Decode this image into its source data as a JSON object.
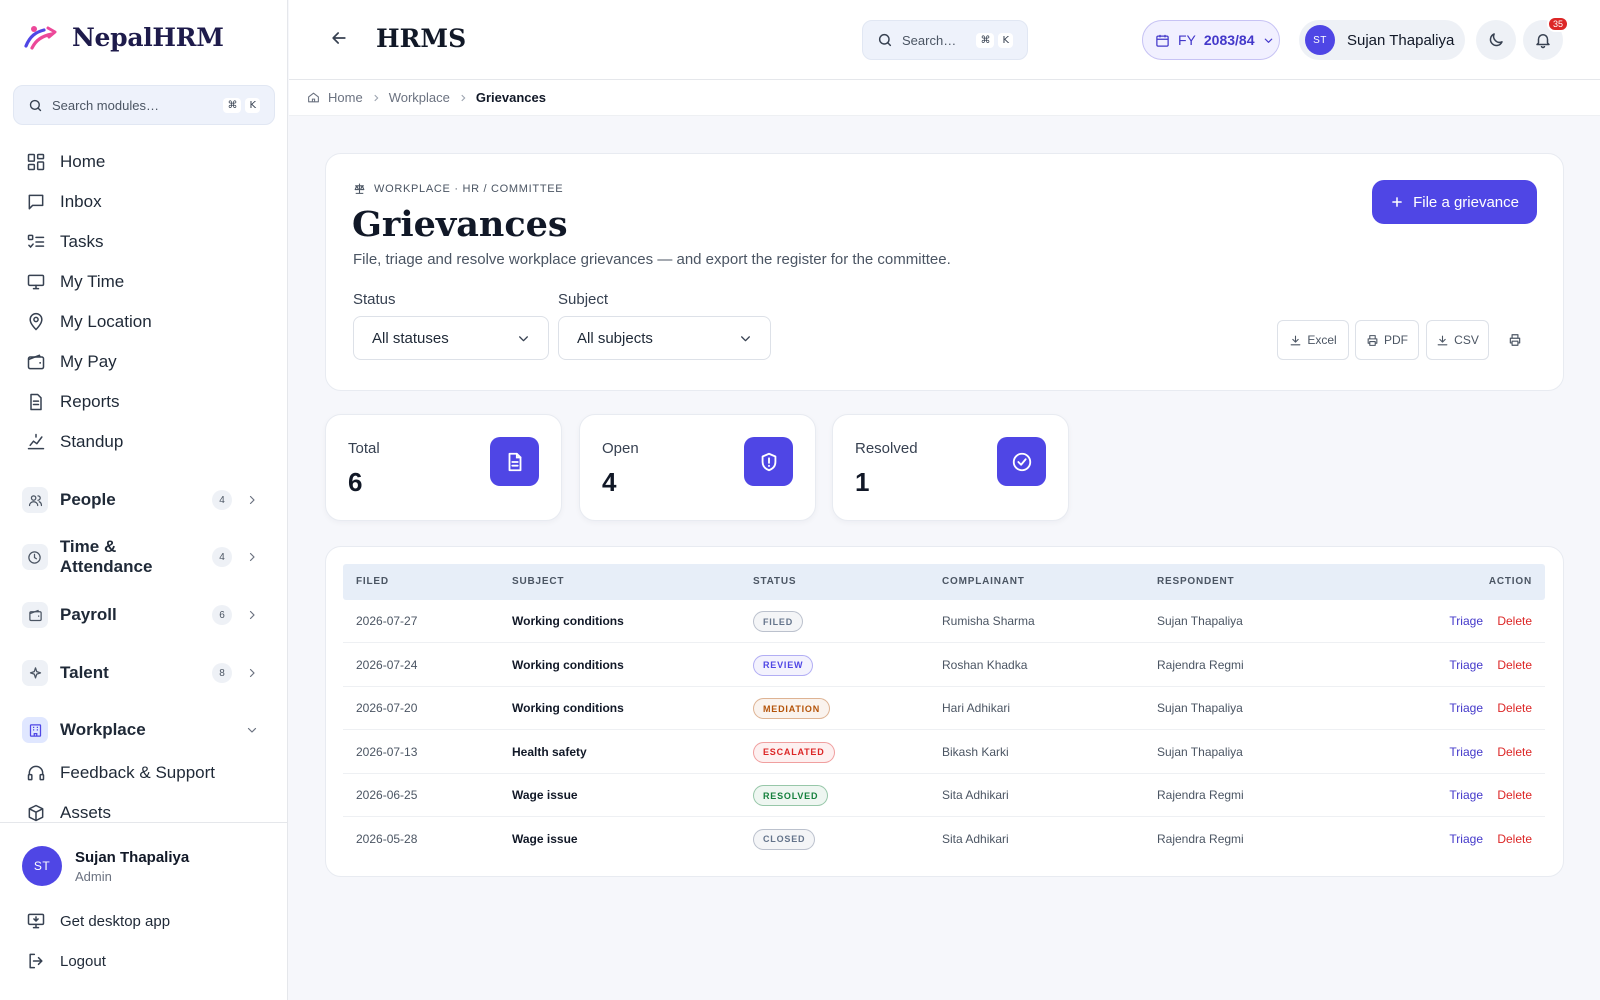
{
  "brand": {
    "name": "NepalHRM"
  },
  "sidebar": {
    "search_placeholder": "Search modules…",
    "kbd": [
      "⌘",
      "K"
    ],
    "items": [
      {
        "label": "Home",
        "icon": "dashboard-icon"
      },
      {
        "label": "Inbox",
        "icon": "message-icon"
      },
      {
        "label": "Tasks",
        "icon": "checklist-icon"
      },
      {
        "label": "My Time",
        "icon": "monitor-icon"
      },
      {
        "label": "My Location",
        "icon": "map-pin-icon"
      },
      {
        "label": "My Pay",
        "icon": "wallet-icon"
      },
      {
        "label": "Reports",
        "icon": "document-icon"
      },
      {
        "label": "Standup",
        "icon": "standup-icon"
      }
    ],
    "groups": [
      {
        "label": "People",
        "count": "4",
        "icon": "users-icon"
      },
      {
        "label": "Time & Attendance",
        "count": "4",
        "icon": "clock-icon"
      },
      {
        "label": "Payroll",
        "count": "6",
        "icon": "wallet-icon"
      },
      {
        "label": "Talent",
        "count": "8",
        "icon": "sparkle-icon"
      },
      {
        "label": "Workplace",
        "icon": "building-icon"
      }
    ],
    "sub_items": [
      {
        "label": "Feedback & Support",
        "icon": "headset-icon"
      },
      {
        "label": "Assets",
        "icon": "box-icon"
      }
    ],
    "profile": {
      "initials": "ST",
      "name": "Sujan Thapaliya",
      "role": "Admin"
    },
    "desktop_app": "Get desktop app",
    "logout": "Logout"
  },
  "header": {
    "title": "HRMS",
    "search_placeholder": "Search…",
    "kbd": [
      "⌘",
      "K"
    ],
    "fy_prefix": "FY",
    "fy_value": "2083/84",
    "user_initials": "ST",
    "user_name": "Sujan Thapaliya",
    "notifications": "35"
  },
  "breadcrumb": {
    "home": "Home",
    "section": "Workplace",
    "current": "Grievances"
  },
  "page": {
    "eyebrow": "WORKPLACE · HR / COMMITTEE",
    "title": "Grievances",
    "subtitle": "File, triage and resolve workplace grievances — and export the register for the committee.",
    "primary_action": "File a grievance",
    "filters": {
      "status_label": "Status",
      "status_value": "All statuses",
      "subject_label": "Subject",
      "subject_value": "All subjects"
    },
    "exports": {
      "excel": "Excel",
      "pdf": "PDF",
      "csv": "CSV"
    }
  },
  "stats": [
    {
      "label": "Total",
      "value": "6",
      "icon": "document-icon"
    },
    {
      "label": "Open",
      "value": "4",
      "icon": "shield-alert-icon"
    },
    {
      "label": "Resolved",
      "value": "1",
      "icon": "check-circle-icon"
    }
  ],
  "table": {
    "columns": [
      "FILED",
      "SUBJECT",
      "STATUS",
      "COMPLAINANT",
      "RESPONDENT",
      "ACTION"
    ],
    "triage_label": "Triage",
    "delete_label": "Delete",
    "rows": [
      {
        "filed": "2026-07-27",
        "subject": "Working conditions",
        "status": "FILED",
        "complainant": "Rumisha Sharma",
        "respondent": "Sujan Thapaliya"
      },
      {
        "filed": "2026-07-24",
        "subject": "Working conditions",
        "status": "REVIEW",
        "complainant": "Roshan Khadka",
        "respondent": "Rajendra Regmi"
      },
      {
        "filed": "2026-07-20",
        "subject": "Working conditions",
        "status": "MEDIATION",
        "complainant": "Hari Adhikari",
        "respondent": "Sujan Thapaliya"
      },
      {
        "filed": "2026-07-13",
        "subject": "Health safety",
        "status": "ESCALATED",
        "complainant": "Bikash Karki",
        "respondent": "Sujan Thapaliya"
      },
      {
        "filed": "2026-06-25",
        "subject": "Wage issue",
        "status": "RESOLVED",
        "complainant": "Sita Adhikari",
        "respondent": "Rajendra Regmi"
      },
      {
        "filed": "2026-05-28",
        "subject": "Wage issue",
        "status": "CLOSED",
        "complainant": "Sita Adhikari",
        "respondent": "Rajendra Regmi"
      }
    ]
  },
  "colors": {
    "accent": "#4f46e5",
    "danger": "#dc2626",
    "status": {
      "FILED": "#64748b",
      "REVIEW": "#4f46e5",
      "MEDIATION": "#b45309",
      "ESCALATED": "#dc2626",
      "RESOLVED": "#15803d",
      "CLOSED": "#64748b"
    }
  }
}
